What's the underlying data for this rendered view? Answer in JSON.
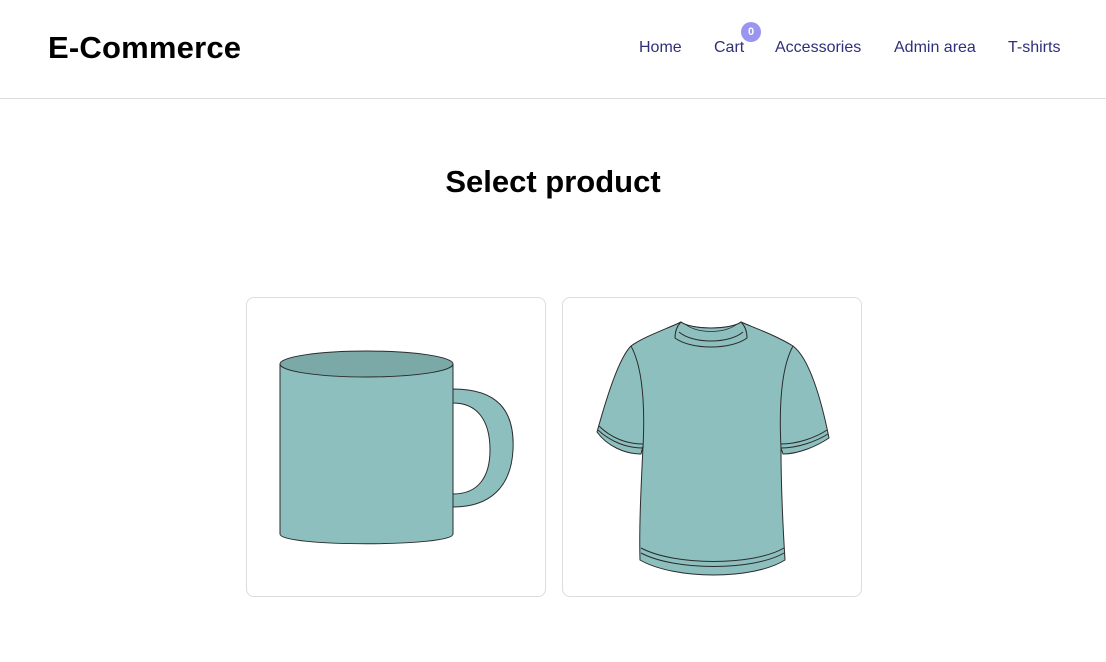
{
  "header": {
    "brand": "E-Commerce",
    "nav": {
      "home": "Home",
      "cart": "Cart",
      "cart_count": "0",
      "accessories": "Accessories",
      "admin": "Admin area",
      "tshirts": "T-shirts"
    }
  },
  "main": {
    "title": "Select product",
    "products": [
      {
        "icon": "mug-icon"
      },
      {
        "icon": "tshirt-icon"
      }
    ]
  },
  "colors": {
    "product_fill": "#8dbfbe",
    "product_fill_dark": "#7aa9a8",
    "nav_link": "#2f2f7a",
    "badge": "#9b95f2"
  }
}
